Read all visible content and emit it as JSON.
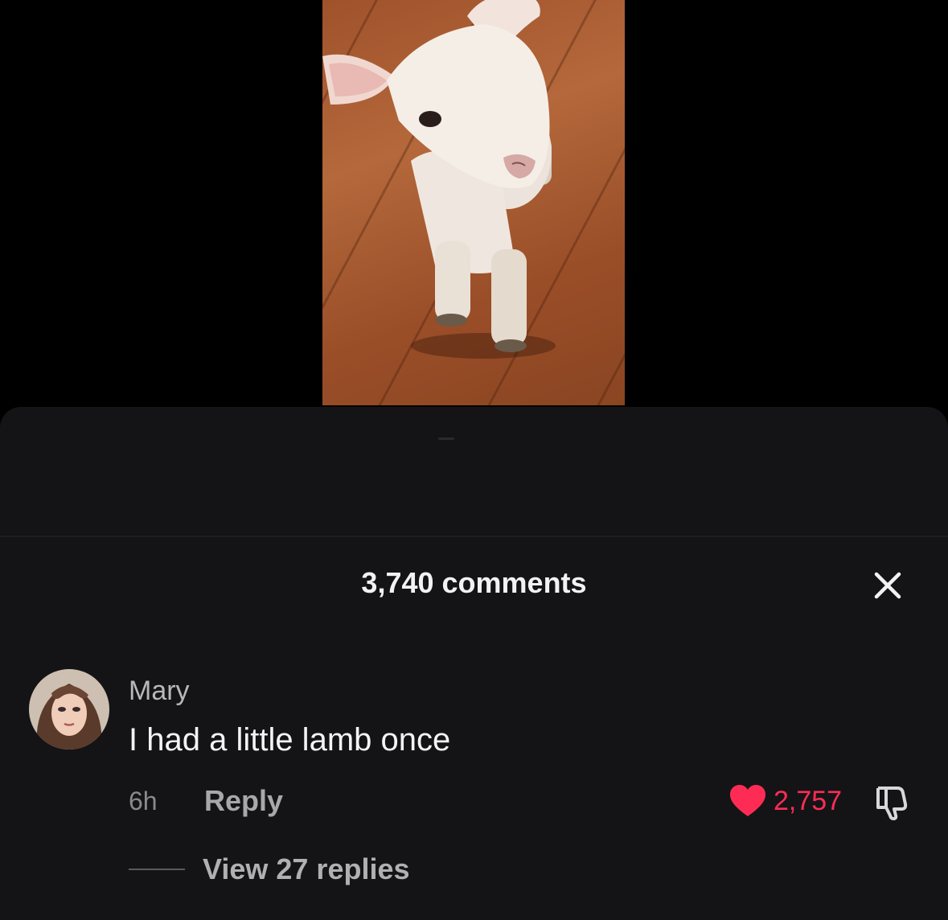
{
  "comments_panel": {
    "title": "3,740 comments"
  },
  "comment": {
    "username": "Mary",
    "text": "I had a little lamb once",
    "timestamp": "6h",
    "reply_label": "Reply",
    "like_count": "2,757",
    "view_replies_label": "View 27 replies"
  },
  "colors": {
    "like_accent": "#fe2c55",
    "sheet_background": "#141416"
  },
  "icons": {
    "close": "close-icon",
    "like": "heart-icon",
    "dislike": "thumbs-down-icon"
  }
}
